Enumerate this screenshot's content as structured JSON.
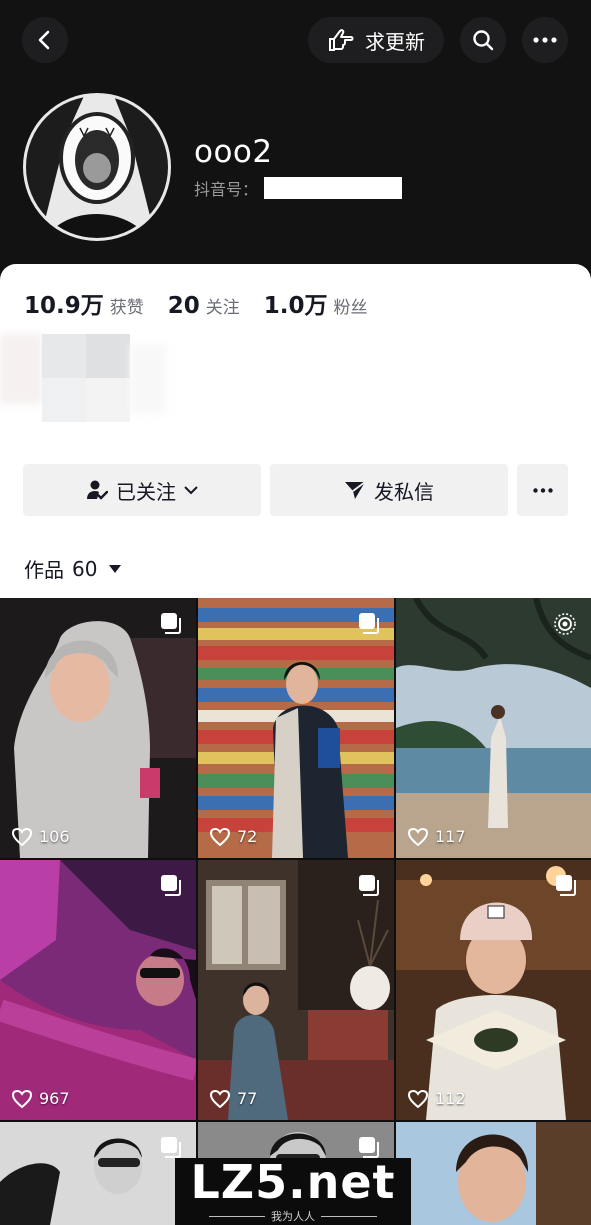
{
  "header": {
    "update_label": "求更新",
    "icons": {
      "back": "chevron-left-icon",
      "update": "hand-pointer-icon",
      "search": "search-icon",
      "more": "ellipsis-icon"
    }
  },
  "profile": {
    "nickname": "ooo2",
    "id_label": "抖音号：",
    "avatar": "open-mouth-illustration"
  },
  "stats": [
    {
      "num": "10.9万",
      "label": "获赞"
    },
    {
      "num": "20",
      "label": "关注"
    },
    {
      "num": "1.0万",
      "label": "粉丝"
    }
  ],
  "actions": {
    "follow_label": "已关注",
    "message_label": "发私信",
    "more": "ellipsis-icon"
  },
  "works": {
    "label": "作品",
    "count": "60"
  },
  "grid": [
    {
      "likes": "106",
      "badge": "multi-image",
      "bg": "#2b2428"
    },
    {
      "likes": "72",
      "badge": "multi-image",
      "bg": "#b86a45"
    },
    {
      "likes": "117",
      "badge": "live-photo",
      "bg": "#6f8fa3"
    },
    {
      "likes": "967",
      "badge": "multi-image",
      "bg": "#8a2f7c"
    },
    {
      "likes": "77",
      "badge": "multi-image",
      "bg": "#4a3b32"
    },
    {
      "likes": "112",
      "badge": "multi-image",
      "bg": "#7a5230"
    },
    {
      "likes": "",
      "badge": "multi-image",
      "bg": "#3a3a3a"
    },
    {
      "likes": "",
      "badge": "multi-image",
      "bg": "#555555"
    },
    {
      "likes": "",
      "badge": "",
      "bg": "#a88b76"
    }
  ],
  "watermark": {
    "title": "LZ5.net",
    "subtitle": "我为人人"
  }
}
